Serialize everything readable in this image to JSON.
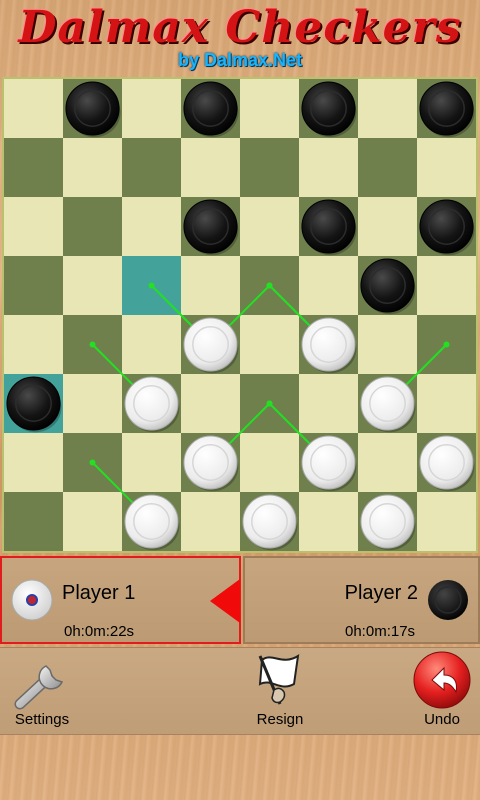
{
  "header": {
    "title": "Dalmax Checkers",
    "subtitle": "by Dalmax.Net"
  },
  "board": {
    "size": 8,
    "light_color": "#e7e6b4",
    "dark_color": "#6f804d",
    "highlight_color": "#43a39b",
    "highlight_squares": [
      [
        3,
        2
      ],
      [
        5,
        0
      ]
    ],
    "black_pieces": [
      [
        0,
        1
      ],
      [
        0,
        3
      ],
      [
        0,
        5
      ],
      [
        0,
        7
      ],
      [
        2,
        3
      ],
      [
        2,
        5
      ],
      [
        2,
        7
      ],
      [
        3,
        6
      ],
      [
        5,
        0
      ]
    ],
    "white_pieces": [
      [
        4,
        3
      ],
      [
        4,
        5
      ],
      [
        5,
        2
      ],
      [
        5,
        6
      ],
      [
        6,
        3
      ],
      [
        6,
        5
      ],
      [
        6,
        7
      ],
      [
        7,
        2
      ],
      [
        7,
        4
      ],
      [
        7,
        6
      ]
    ],
    "move_hints": [
      [
        [
          4,
          3
        ],
        [
          3,
          2
        ]
      ],
      [
        [
          4,
          3
        ],
        [
          3,
          4
        ]
      ],
      [
        [
          4,
          5
        ],
        [
          3,
          4
        ]
      ],
      [
        [
          5,
          2
        ],
        [
          4,
          1
        ]
      ],
      [
        [
          5,
          6
        ],
        [
          4,
          7
        ]
      ],
      [
        [
          6,
          3
        ],
        [
          5,
          4
        ]
      ],
      [
        [
          6,
          5
        ],
        [
          5,
          4
        ]
      ],
      [
        [
          7,
          2
        ],
        [
          6,
          1
        ]
      ]
    ],
    "hint_color": "#22e022"
  },
  "players": [
    {
      "name": "Player 1",
      "time": "0h:0m:22s",
      "piece": "white",
      "active": true
    },
    {
      "name": "Player 2",
      "time": "0h:0m:17s",
      "piece": "black",
      "active": false
    }
  ],
  "toolbar": {
    "settings_label": "Settings",
    "resign_label": "Resign",
    "undo_label": "Undo"
  },
  "colors": {
    "title": "#d41414",
    "subtitle": "#17b4ff",
    "active_border": "#e01c1c",
    "undo_button": "#e52020"
  }
}
